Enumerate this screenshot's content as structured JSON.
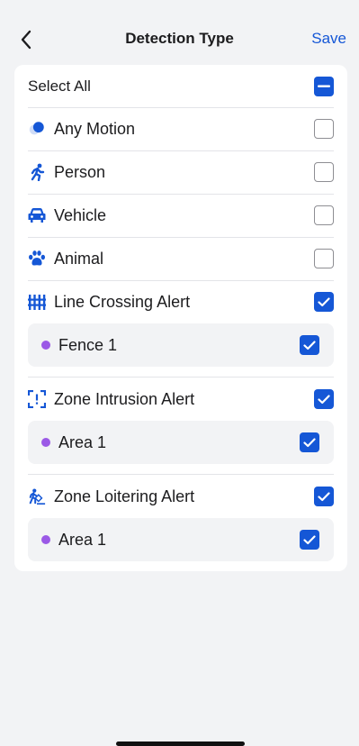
{
  "header": {
    "title": "Detection Type",
    "save_label": "Save",
    "back_icon": "chevron-left-icon"
  },
  "colors": {
    "accent": "#1557d6",
    "zone_dot": "#9b59e6",
    "background": "#f2f3f5"
  },
  "select_all": {
    "label": "Select All",
    "state": "indeterminate"
  },
  "items": [
    {
      "label": "Any Motion",
      "icon": "motion-icon",
      "checked": false
    },
    {
      "label": "Person",
      "icon": "person-running-icon",
      "checked": false
    },
    {
      "label": "Vehicle",
      "icon": "car-icon",
      "checked": false
    },
    {
      "label": "Animal",
      "icon": "paw-icon",
      "checked": false
    },
    {
      "label": "Line Crossing Alert",
      "icon": "fence-icon",
      "checked": true,
      "sub": {
        "label": "Fence 1",
        "checked": true
      }
    },
    {
      "label": "Zone Intrusion Alert",
      "icon": "zone-intrusion-icon",
      "checked": true,
      "sub": {
        "label": "Area 1",
        "checked": true
      }
    },
    {
      "label": "Zone Loitering Alert",
      "icon": "loitering-icon",
      "checked": true,
      "sub": {
        "label": "Area 1",
        "checked": true
      }
    }
  ]
}
